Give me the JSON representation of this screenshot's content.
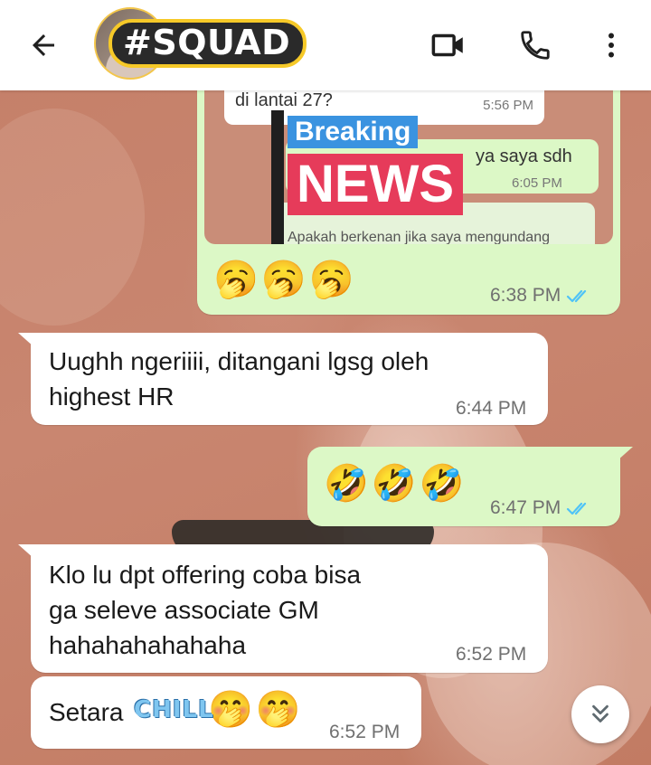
{
  "header": {
    "title": "#SQUAD",
    "back_icon": "arrow-back-icon",
    "video_icon": "video-call-icon",
    "call_icon": "phone-icon",
    "menu_icon": "more-vert-icon"
  },
  "embedded_image": {
    "line1": "di lantai 27?",
    "time1": "5:56 PM",
    "line2": "ya saya sdh",
    "time2": "6:05 PM",
    "quoted": "Apakah berkenan jika saya mengundang",
    "breaking": "Breaking",
    "news": "NEWS"
  },
  "messages": [
    {
      "id": "m1",
      "direction": "out",
      "emoji": [
        "🥱",
        "🥱",
        "🥱"
      ],
      "time": "6:38 PM",
      "read": true
    },
    {
      "id": "m2",
      "direction": "in",
      "text": "Uughh ngeriiii, ditangani lgsg oleh\nhighest HR",
      "time": "6:44 PM"
    },
    {
      "id": "m3",
      "direction": "out",
      "emoji": [
        "🤣",
        "🤣",
        "🤣"
      ],
      "time": "6:47 PM",
      "read": true
    },
    {
      "id": "m4",
      "direction": "in",
      "text": "Klo lu dpt offering coba bisa\nga seleve associate GM\nhahahahahahaha",
      "time": "6:52 PM"
    },
    {
      "id": "m5",
      "direction": "in",
      "text": "Setara",
      "emoji": [
        "🤭",
        "🤭"
      ],
      "time": "6:52 PM"
    }
  ],
  "sticker_text": "CHILL",
  "colors": {
    "outgoing_bubble": "#dcf8c6",
    "incoming_bubble": "#ffffff",
    "read_ticks": "#4fc3f7",
    "header_bg": "#ffffff"
  },
  "scroll_button_icon": "double-chevron-down-icon"
}
